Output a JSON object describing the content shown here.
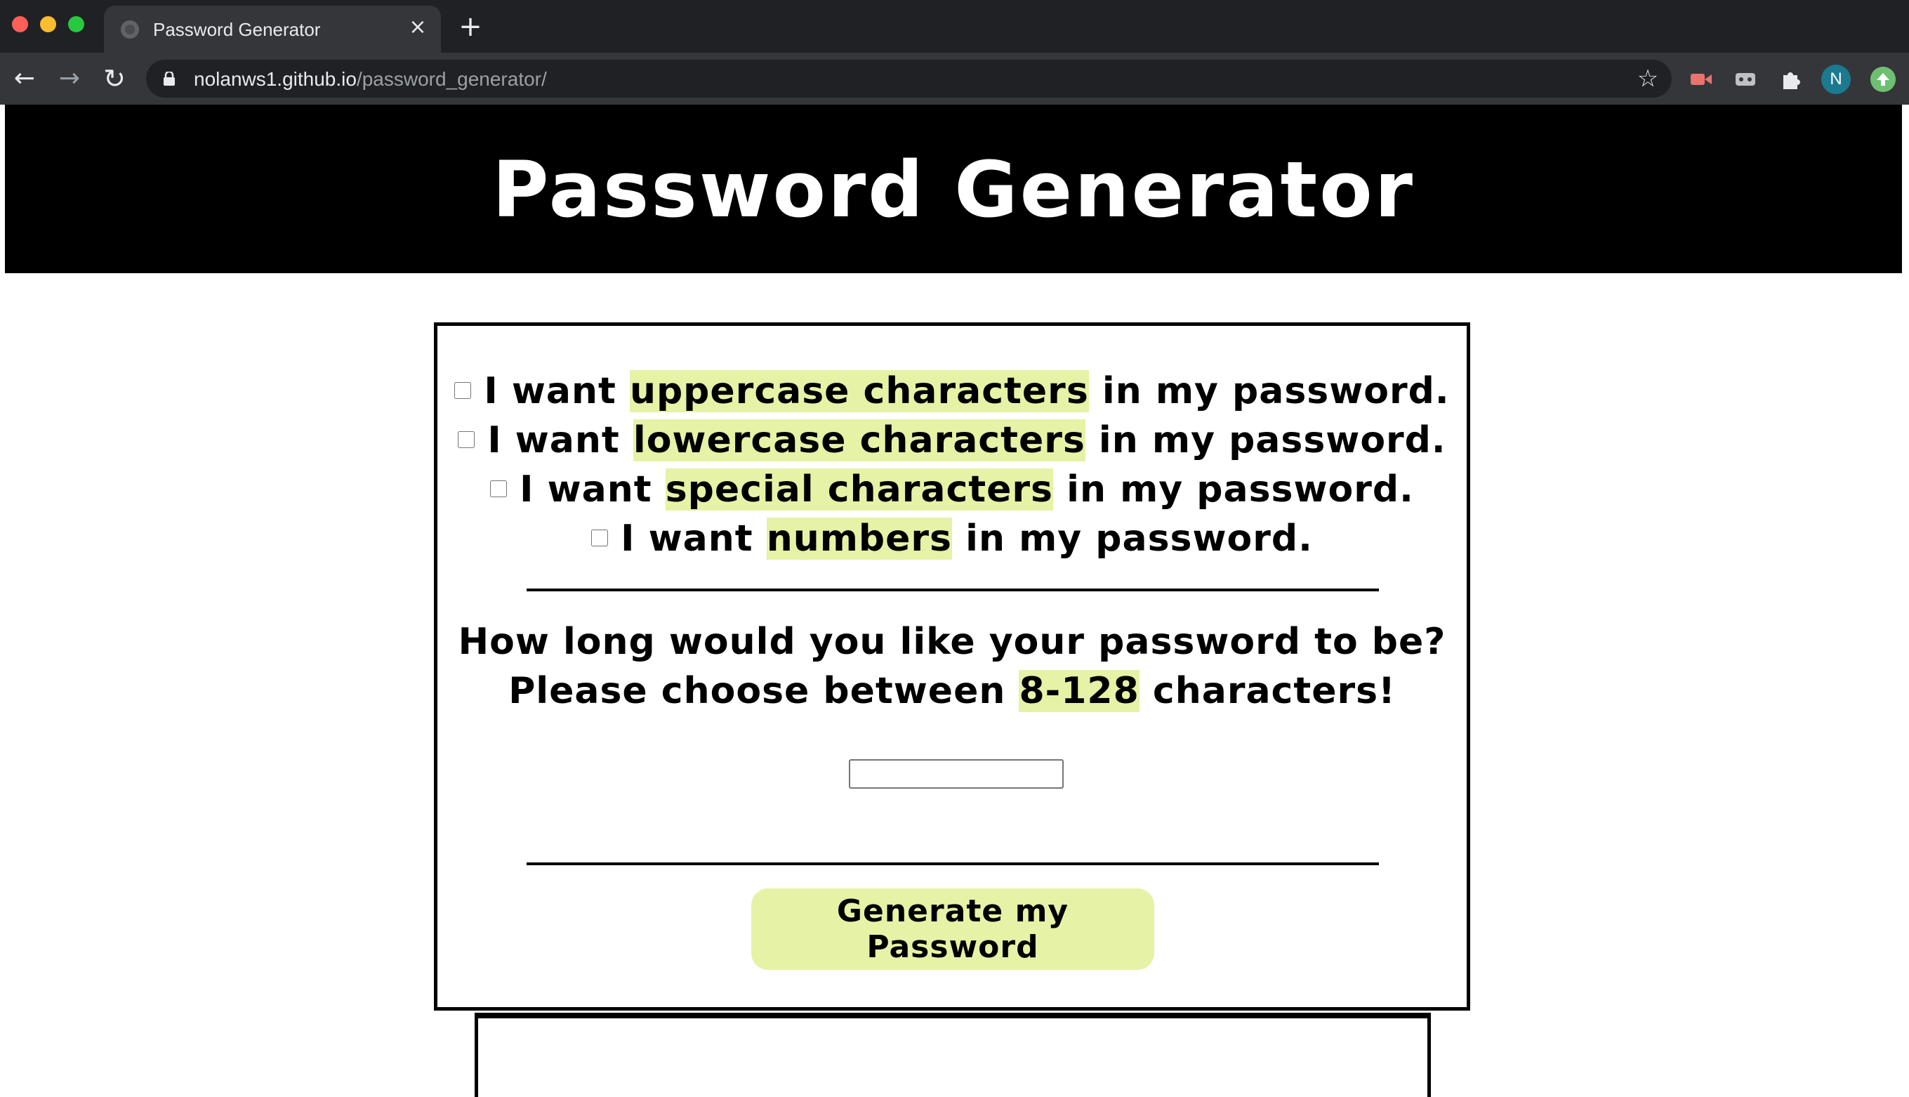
{
  "browser": {
    "tab_title": "Password Generator",
    "tab_close": "×",
    "new_tab": "+",
    "url_host": "nolanws1.github.io",
    "url_path": "/password_generator/",
    "avatar_letter": "N"
  },
  "header": {
    "title": "Password Generator"
  },
  "options": [
    {
      "before": "I want ",
      "highlight": "uppercase characters",
      "after": " in my password."
    },
    {
      "before": "I want ",
      "highlight": "lowercase characters",
      "after": " in my password."
    },
    {
      "before": "I want ",
      "highlight": "special characters",
      "after": " in my password."
    },
    {
      "before": "I want ",
      "highlight": "numbers",
      "after": " in my password."
    }
  ],
  "length_prompt": {
    "line1": "How long would you like your password to be?",
    "line2_before": "Please choose between ",
    "line2_highlight": "8-128",
    "line2_after": " characters!"
  },
  "length_input": {
    "value": "",
    "placeholder": ""
  },
  "generate_button": {
    "label": "Generate my Password"
  },
  "colors": {
    "highlight": "#e6f2a6",
    "header_bg": "#000000"
  }
}
